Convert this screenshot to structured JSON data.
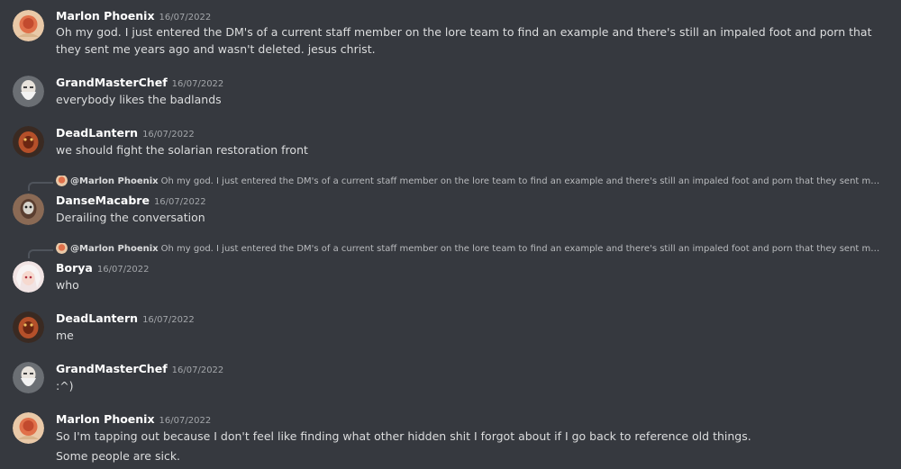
{
  "messages": [
    {
      "author": "Marlon Phoenix",
      "timestamp": "16/07/2022",
      "avatar": "marlon-avatar",
      "lines": [
        "Oh my god. I just entered the DM's of a current staff member on the lore team to find an example and there's still an impaled foot and porn that they sent me years ago and wasn't  deleted. jesus christ."
      ]
    },
    {
      "author": "GrandMasterChef",
      "timestamp": "16/07/2022",
      "avatar": "grandmasterchef-avatar",
      "lines": [
        "everybody likes the badlands"
      ]
    },
    {
      "author": "DeadLantern",
      "timestamp": "16/07/2022",
      "avatar": "deadlantern-avatar",
      "lines": [
        "we should fight the solarian restoration front"
      ]
    },
    {
      "author": "DanseMacabre",
      "timestamp": "16/07/2022",
      "avatar": "dansemacabre-avatar",
      "reply": {
        "author": "@Marlon Phoenix",
        "text": "Oh my god. I just entered the DM's of a current staff member on the lore team to find an example and there's still an impaled foot and porn that they sent me y..."
      },
      "lines": [
        "Derailing the conversation"
      ]
    },
    {
      "author": "Borya",
      "timestamp": "16/07/2022",
      "avatar": "borya-avatar",
      "reply": {
        "author": "@Marlon Phoenix",
        "text": "Oh my god. I just entered the DM's of a current staff member on the lore team to find an example and there's still an impaled foot and porn that they sent me y..."
      },
      "lines": [
        "who"
      ]
    },
    {
      "author": "DeadLantern",
      "timestamp": "16/07/2022",
      "avatar": "deadlantern-avatar",
      "lines": [
        "me"
      ]
    },
    {
      "author": "GrandMasterChef",
      "timestamp": "16/07/2022",
      "avatar": "grandmasterchef-avatar",
      "lines": [
        ":^)"
      ]
    },
    {
      "author": "Marlon Phoenix",
      "timestamp": "16/07/2022",
      "avatar": "marlon-avatar",
      "lines": [
        "So I'm tapping out because I don't feel like finding what other hidden shit I forgot about if I go back to reference old things.",
        "Some people are sick."
      ]
    }
  ],
  "colors": {
    "background": "#36393f",
    "username": "#ffffff",
    "message_text": "#dcddde",
    "timestamp": "#a3a6aa",
    "reply_text": "#b9bbbe",
    "reply_line": "#4f545c"
  }
}
